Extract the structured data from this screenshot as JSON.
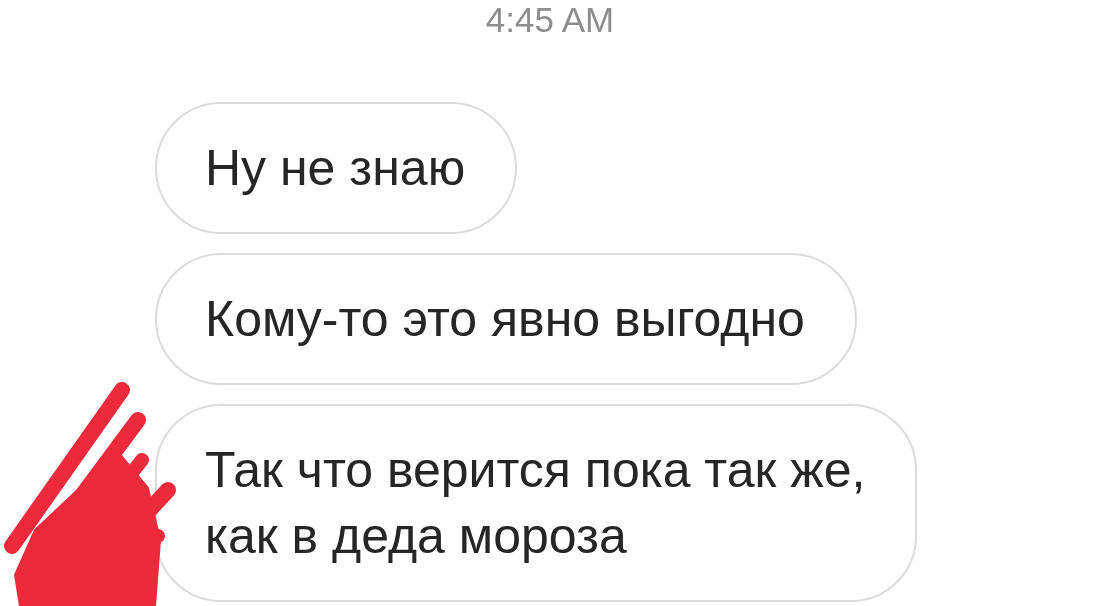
{
  "timestamp": "4:45 AM",
  "messages": [
    {
      "text": "Ну не знаю"
    },
    {
      "text": "Кому-то это явно выгодно"
    },
    {
      "text": "Так что верится пока так же,\nкак в деда мороза"
    }
  ]
}
